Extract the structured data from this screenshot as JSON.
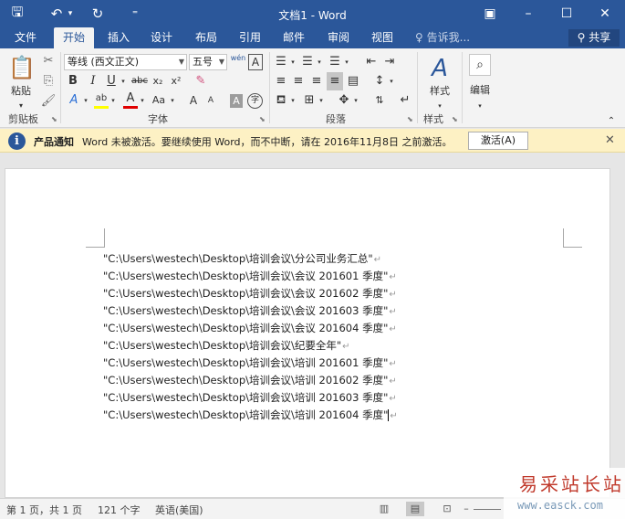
{
  "window": {
    "title": "文档1 - Word",
    "controls": {
      "restore": "▣",
      "minimize": "–",
      "maximize": "☐",
      "close": "✕"
    }
  },
  "quick_access": {
    "save": "🖫",
    "undo": "↶",
    "undo_more": "▾",
    "redo": "↻",
    "customize": "⁼"
  },
  "tabs": [
    "文件",
    "开始",
    "插入",
    "设计",
    "布局",
    "引用",
    "邮件",
    "审阅",
    "视图"
  ],
  "active_tab": "开始",
  "tell_me": "告诉我...",
  "share": "共享",
  "ribbon": {
    "clipboard": {
      "label": "剪贴板",
      "paste": "粘贴",
      "cut": "✂",
      "copy": "⎘",
      "format_painter": "🖌"
    },
    "font": {
      "label": "字体",
      "family": "等线 (西文正文)",
      "size": "五号",
      "phonetic": "wén",
      "char_border": "A",
      "bold": "B",
      "italic": "I",
      "underline": "U",
      "strike": "abc",
      "subscript": "x₂",
      "superscript": "x²",
      "clear": "✎",
      "text_effect": "A",
      "highlight": "ab",
      "font_color": "A",
      "change_case": "Aa",
      "grow": "A",
      "shrink": "A",
      "char_shading": "A",
      "enclose": "字"
    },
    "paragraph": {
      "label": "段落"
    },
    "styles": {
      "label": "样式",
      "button": "样式"
    },
    "editing": {
      "button": "编辑"
    }
  },
  "colors": {
    "brand": "#2b579a",
    "highlight": "#ffff00",
    "font_color": "#e00000"
  },
  "notice": {
    "title": "产品通知",
    "text": "Word 未被激活。要继续使用 Word，而不中断，请在 2016年11月8日 之前激活。",
    "activate_button": "激活(A)"
  },
  "document": {
    "lines": [
      "\"C:\\Users\\westech\\Desktop\\培训会议\\分公司业务汇总\"",
      "\"C:\\Users\\westech\\Desktop\\培训会议\\会议 201601 季度\"",
      "\"C:\\Users\\westech\\Desktop\\培训会议\\会议 201602 季度\"",
      "\"C:\\Users\\westech\\Desktop\\培训会议\\会议 201603 季度\"",
      "\"C:\\Users\\westech\\Desktop\\培训会议\\会议 201604 季度\"",
      "\"C:\\Users\\westech\\Desktop\\培训会议\\纪要全年\"",
      "\"C:\\Users\\westech\\Desktop\\培训会议\\培训 201601 季度\"",
      "\"C:\\Users\\westech\\Desktop\\培训会议\\培训 201602 季度\"",
      "\"C:\\Users\\westech\\Desktop\\培训会议\\培训 201603 季度\"",
      "\"C:\\Users\\westech\\Desktop\\培训会议\\培训 201604 季度\""
    ],
    "paragraph_mark": "↵"
  },
  "status": {
    "page": "第 1 页，共 1 页",
    "words": "121 个字",
    "language": "英语(美国)"
  },
  "watermark": {
    "text": "易采站长站",
    "url": "www.easck.com"
  }
}
